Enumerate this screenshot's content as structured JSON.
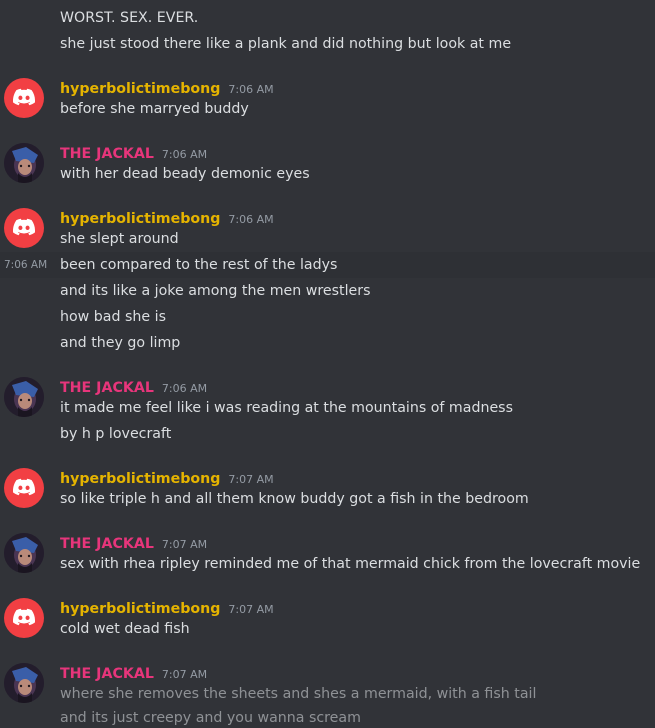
{
  "users": {
    "hyper": {
      "name": "hyperbolictimebong",
      "avatar_icon": "discord-logo-icon"
    },
    "jackal": {
      "name": "THE JACKAL",
      "avatar_icon": "jackal-avatar-icon"
    }
  },
  "colors": {
    "background": "#313338",
    "hyper": "#e5b400",
    "jackal": "#e7357b",
    "discord_red": "#f23f43"
  },
  "messages": {
    "m0": [
      "WORST. SEX. EVER.",
      "she just stood there like a plank and did nothing but look at me"
    ],
    "g1": {
      "time": "7:06 AM",
      "lines": [
        "before she marryed buddy"
      ]
    },
    "g2": {
      "time": "7:06 AM",
      "lines": [
        "with her dead beady demonic eyes"
      ]
    },
    "g3": {
      "time": "7:06 AM",
      "hover_time": "7:06 AM",
      "lines": [
        "she slept around",
        "been compared to the rest of the ladys",
        "and its like a joke among the men wrestlers",
        "how bad she is",
        "and they go limp"
      ]
    },
    "g4": {
      "time": "7:06 AM",
      "lines": [
        "it made me feel like i was reading at the mountains of madness",
        "by h p lovecraft"
      ]
    },
    "g5": {
      "time": "7:07 AM",
      "lines": [
        "so like triple h and all them know buddy got a fish in the bedroom"
      ]
    },
    "g6": {
      "time": "7:07 AM",
      "lines": [
        "sex with rhea ripley reminded me of that mermaid chick from the lovecraft movie"
      ]
    },
    "g7": {
      "time": "7:07 AM",
      "lines": [
        "cold wet dead fish"
      ]
    },
    "g8": {
      "time": "7:07 AM",
      "lines": [
        "where she removes the sheets and shes a mermaid, with a fish tail",
        "and its just creepy and you wanna scream"
      ]
    }
  }
}
